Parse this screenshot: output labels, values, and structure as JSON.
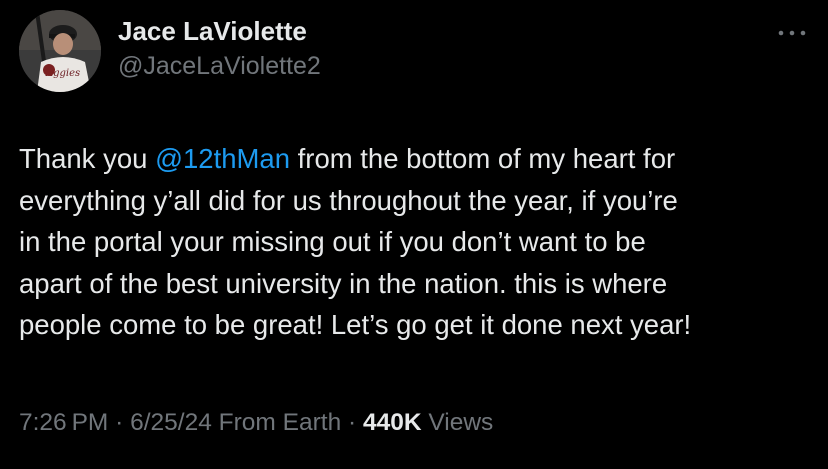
{
  "author": {
    "display_name": "Jace LaViolette",
    "handle": "@JaceLaViolette2",
    "avatar_jersey_text": "Aggies"
  },
  "menu": {
    "icon": "more-horizontal-icon"
  },
  "tweet": {
    "lines": [
      {
        "before": "Thank you ",
        "mention": "@12thMan",
        "after": " from the bottom of my heart for"
      },
      {
        "text": "everything y’all did for us throughout the year, if you’re"
      },
      {
        "text": "in the portal your missing out if you don’t want to be"
      },
      {
        "text": "apart of the best university in the nation. this is where"
      },
      {
        "text": "people come to be great! Let’s go get it done next year!"
      }
    ]
  },
  "meta": {
    "time": "7:26 PM",
    "separator": " · ",
    "date": "6/25/24",
    "source": " From Earth",
    "views_count": "440K",
    "views_label": " Views"
  },
  "colors": {
    "background": "#000000",
    "text": "#e7e9ea",
    "secondary": "#71767b",
    "link": "#1d9bf0"
  }
}
